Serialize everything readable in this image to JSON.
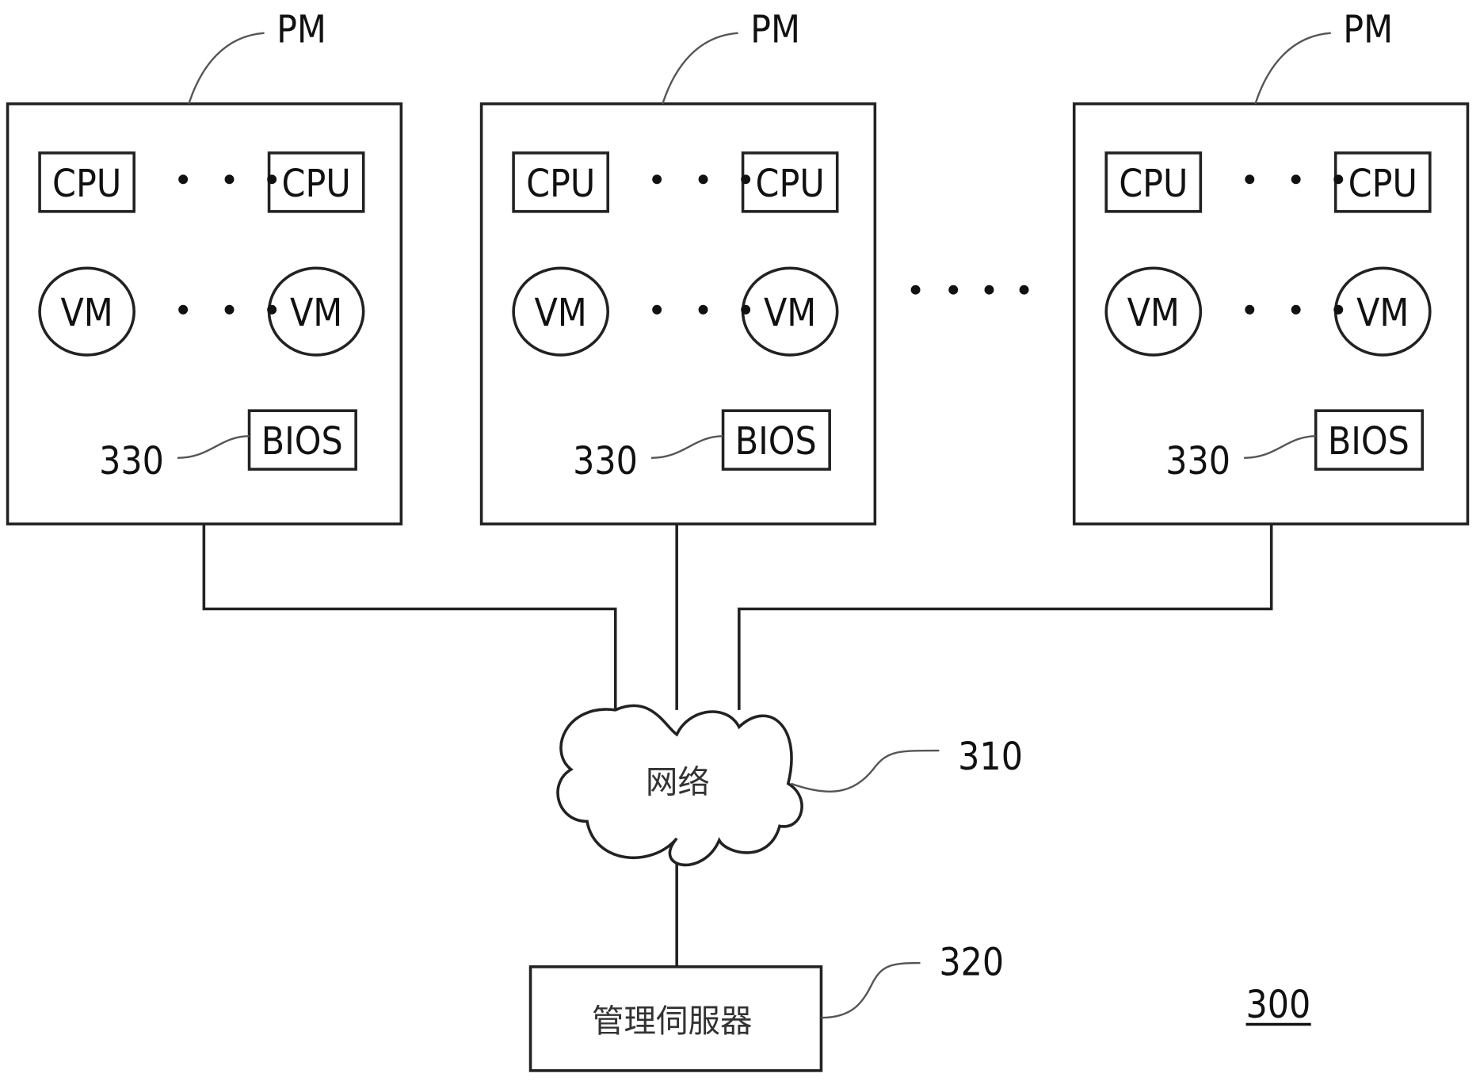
{
  "figure_number": "300",
  "physical_machines": [
    {
      "label": "PM",
      "cpu_first": "CPU",
      "cpu_last": "CPU",
      "vm_first": "VM",
      "vm_last": "VM",
      "bios": "BIOS",
      "bios_ref": "330"
    },
    {
      "label": "PM",
      "cpu_first": "CPU",
      "cpu_last": "CPU",
      "vm_first": "VM",
      "vm_last": "VM",
      "bios": "BIOS",
      "bios_ref": "330"
    },
    {
      "label": "PM",
      "cpu_first": "CPU",
      "cpu_last": "CPU",
      "vm_first": "VM",
      "vm_last": "VM",
      "bios": "BIOS",
      "bios_ref": "330"
    }
  ],
  "network": {
    "label": "网络",
    "ref": "310"
  },
  "server": {
    "label": "管理伺服器",
    "ref": "320"
  }
}
